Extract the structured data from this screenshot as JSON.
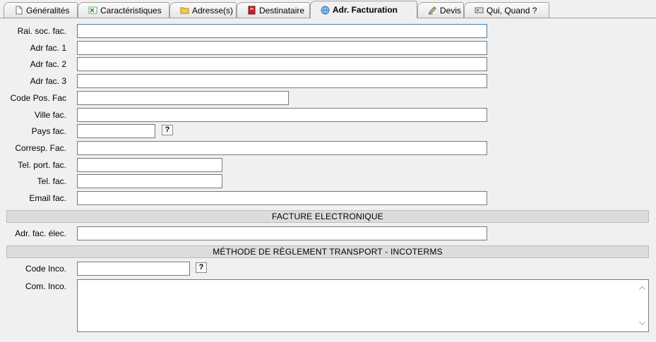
{
  "tabs": [
    {
      "label": "Généralités",
      "icon": "document-icon"
    },
    {
      "label": "Caractéristiques",
      "icon": "spreadsheet-icon"
    },
    {
      "label": "Adresse(s)",
      "icon": "folder-icon"
    },
    {
      "label": "Destinataire",
      "icon": "address-book-icon"
    },
    {
      "label": "Adr. Facturation",
      "icon": "globe-icon",
      "active": true
    },
    {
      "label": "Devis",
      "icon": "pencil-icon"
    },
    {
      "label": "Qui, Quand ?",
      "icon": "card-icon"
    }
  ],
  "fields": {
    "rai_soc": {
      "label": "Rai. soc. fac.",
      "value": ""
    },
    "adr1": {
      "label": "Adr fac. 1",
      "value": ""
    },
    "adr2": {
      "label": "Adr fac. 2",
      "value": ""
    },
    "adr3": {
      "label": "Adr fac. 3",
      "value": ""
    },
    "code_pos": {
      "label": "Code Pos. Fac",
      "value": ""
    },
    "ville": {
      "label": "Ville fac.",
      "value": ""
    },
    "pays": {
      "label": "Pays fac.",
      "value": ""
    },
    "corresp": {
      "label": "Corresp. Fac.",
      "value": ""
    },
    "tel_port": {
      "label": "Tel. port. fac.",
      "value": ""
    },
    "tel": {
      "label": "Tel. fac.",
      "value": ""
    },
    "email": {
      "label": "Email fac.",
      "value": ""
    },
    "adr_elec": {
      "label": "Adr. fac. élec.",
      "value": ""
    },
    "code_inco": {
      "label": "Code Inco.",
      "value": ""
    },
    "com_inco": {
      "label": "Com. Inco.",
      "value": ""
    }
  },
  "sections": {
    "facture_electronique": "FACTURE ELECTRONIQUE",
    "incoterms": "MÉTHODE DE RÈGLEMENT TRANSPORT - INCOTERMS"
  },
  "help_button": "?",
  "colors": {
    "focus_border": "#3c7fb1",
    "section_bg": "#dcdcdc",
    "window_bg": "#f0f0f0"
  }
}
